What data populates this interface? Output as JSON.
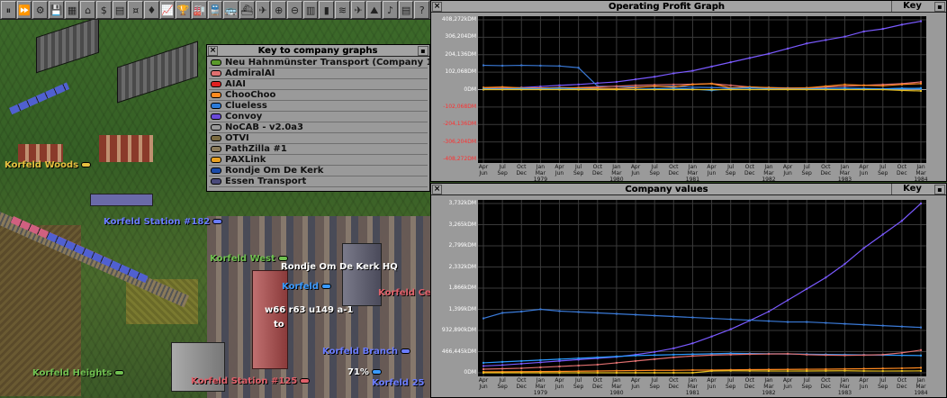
{
  "toolbar": {
    "buttons": [
      {
        "name": "pause-button",
        "glyph": "⏸"
      },
      {
        "name": "fast-forward-button",
        "glyph": "⏩"
      },
      {
        "name": "settings-button",
        "glyph": "⚙"
      },
      {
        "name": "save-button",
        "glyph": "💾"
      },
      {
        "name": "minimap-button",
        "glyph": "▦"
      },
      {
        "name": "towns-button",
        "glyph": "⌂"
      },
      {
        "name": "subsidies-button",
        "glyph": "$"
      },
      {
        "name": "stations-button",
        "glyph": "▤"
      },
      {
        "name": "finances-button",
        "glyph": "¤"
      },
      {
        "name": "company-button",
        "glyph": "♦"
      },
      {
        "name": "graphs-button",
        "glyph": "📈"
      },
      {
        "name": "league-button",
        "glyph": "🏆"
      },
      {
        "name": "industries-button",
        "glyph": "🏭"
      },
      {
        "name": "trains-button",
        "glyph": "🚆"
      },
      {
        "name": "road-vehicles-button",
        "glyph": "🚌"
      },
      {
        "name": "ships-button",
        "glyph": "⛴"
      },
      {
        "name": "aircraft-button",
        "glyph": "✈"
      },
      {
        "name": "zoom-in-button",
        "glyph": "⊕"
      },
      {
        "name": "zoom-out-button",
        "glyph": "⊖"
      },
      {
        "name": "build-rail-button",
        "glyph": "▥"
      },
      {
        "name": "build-road-button",
        "glyph": "▮"
      },
      {
        "name": "build-water-button",
        "glyph": "≋"
      },
      {
        "name": "build-air-button",
        "glyph": "✈"
      },
      {
        "name": "landscaping-button",
        "glyph": "⛰"
      },
      {
        "name": "sound-button",
        "glyph": "♪"
      },
      {
        "name": "news-button",
        "glyph": "▤"
      },
      {
        "name": "help-button",
        "glyph": "?"
      }
    ]
  },
  "map": {
    "labels": [
      {
        "text": "Korfeld Woods",
        "color": "#e8c040",
        "pill": "#e8c040"
      },
      {
        "text": "Korfeld Station #182",
        "color": "#5a6cff",
        "pill": "#6a7cff"
      },
      {
        "text": "Korfeld West",
        "color": "#70c050",
        "pill": "#70c050"
      },
      {
        "text": "Rondje Om De Kerk HQ",
        "color": "#ffffff",
        "pill": ""
      },
      {
        "text": "Korfeld",
        "color": "#3a9aff",
        "pill": "#3a9aff"
      },
      {
        "text": "Korfeld Cen",
        "color": "#e0606a",
        "pill": ""
      },
      {
        "text": "w66 r63 u149 a-1",
        "color": "#ffffff",
        "pill": ""
      },
      {
        "text": "to",
        "color": "#ffffff",
        "pill": ""
      },
      {
        "text": "Korfeld Branch",
        "color": "#5a6cff",
        "pill": "#6a7cff"
      },
      {
        "text": "71%",
        "color": "#ffffff",
        "pill": "#3a9aff"
      },
      {
        "text": "Korfeld Heights",
        "color": "#70c050",
        "pill": "#70c050"
      },
      {
        "text": "Korfeld Station #125",
        "color": "#e0606a",
        "pill": "#e0606a"
      },
      {
        "text": "Korfeld 25",
        "color": "#5a6cff",
        "pill": ""
      }
    ]
  },
  "key_window": {
    "title": "Key to company graphs",
    "companies": [
      {
        "name": "Neu Hahnmünster Transport (Company 1)",
        "color": "#5a9a2a"
      },
      {
        "name": "AdmiralAI",
        "color": "#e07070"
      },
      {
        "name": "AIAI",
        "color": "#e02020"
      },
      {
        "name": "ChooChoo",
        "color": "#ff8a20"
      },
      {
        "name": "Clueless",
        "color": "#2a7ad8"
      },
      {
        "name": "Convoy",
        "color": "#6a4ad8"
      },
      {
        "name": "NoCAB - v2.0a3",
        "color": "#9a9a9a"
      },
      {
        "name": "OTVI",
        "color": "#7a6a40"
      },
      {
        "name": "PathZilla #1",
        "color": "#8a7a5a"
      },
      {
        "name": "PAXLink",
        "color": "#e8a020"
      },
      {
        "name": "Rondje Om De Kerk",
        "color": "#1a4aa8"
      },
      {
        "name": "Essen Transport",
        "color": "#4a4a7a"
      }
    ]
  },
  "profit_graph": {
    "title": "Operating Profit Graph",
    "key_label": "Key"
  },
  "value_graph": {
    "title": "Company values",
    "key_label": "Key"
  },
  "chart_data": [
    {
      "type": "line",
      "title": "Operating Profit Graph",
      "ylim": [
        -408272,
        408272
      ],
      "ytick_labels": [
        "408,272kDM",
        "306,204DM",
        "204,136DM",
        "102,068DM",
        "0DM",
        "-102,068DM",
        "-204,136DM",
        "-306,204DM",
        "-408,272DM"
      ],
      "ytick_values": [
        408272,
        306204,
        204136,
        102068,
        0,
        -102068,
        -204136,
        -306204,
        -408272
      ],
      "x_top": [
        "Apr",
        "Jul",
        "Oct",
        "Jan",
        "Apr",
        "Jul",
        "Oct",
        "Jan",
        "Apr",
        "Jul",
        "Oct",
        "Jan",
        "Apr",
        "Jul",
        "Oct",
        "Jan",
        "Apr",
        "Jul",
        "Oct",
        "Jan",
        "Apr",
        "Jul",
        "Oct",
        "Jan"
      ],
      "x_bottom": [
        "Jun",
        "Sep",
        "Dec",
        "Mar",
        "Jun",
        "Sep",
        "Dec",
        "Mar",
        "Jun",
        "Sep",
        "Dec",
        "Mar",
        "Jun",
        "Sep",
        "Dec",
        "Mar",
        "Jun",
        "Sep",
        "Dec",
        "Mar",
        "Jun",
        "Sep",
        "Dec",
        "Mar"
      ],
      "x_year": [
        "",
        "",
        "",
        "1979",
        "",
        "",
        "",
        "1980",
        "",
        "",
        "",
        "1981",
        "",
        "",
        "",
        "1982",
        "",
        "",
        "",
        "1983",
        "",
        "",
        "",
        "1984"
      ],
      "series": [
        {
          "name": "Convoy",
          "color": "#7a5aff",
          "values": [
            5000,
            8000,
            12000,
            18000,
            25000,
            30000,
            38000,
            45000,
            60000,
            75000,
            95000,
            110000,
            135000,
            160000,
            185000,
            210000,
            240000,
            270000,
            290000,
            310000,
            340000,
            355000,
            380000,
            400000
          ]
        },
        {
          "name": "Rondje Om De Kerk",
          "color": "#3a7ad8",
          "values": [
            142000,
            140000,
            142000,
            140000,
            138000,
            128000,
            20000,
            18000,
            15000,
            18000,
            20000,
            14000,
            12000,
            10000,
            8000,
            12000,
            10000,
            8000,
            6000,
            9000,
            7000,
            5000,
            8000,
            6000
          ]
        },
        {
          "name": "AdmiralAI",
          "color": "#e07070",
          "values": [
            8000,
            6000,
            9000,
            10000,
            7000,
            12000,
            15000,
            20000,
            25000,
            28000,
            30000,
            32000,
            35000,
            25000,
            15000,
            10000,
            8000,
            10000,
            15000,
            20000,
            25000,
            30000,
            35000,
            45000
          ]
        },
        {
          "name": "ChooChoo",
          "color": "#ff8a20",
          "values": [
            12000,
            15000,
            10000,
            8000,
            12000,
            10000,
            8000,
            6000,
            12000,
            20000,
            15000,
            30000,
            35000,
            10000,
            15000,
            12000,
            8000,
            10000,
            20000,
            30000,
            25000,
            22000,
            30000,
            35000
          ]
        },
        {
          "name": "Clueless",
          "color": "#2a9aff",
          "values": [
            5000,
            4000,
            6000,
            5000,
            8000,
            4000,
            2000,
            0,
            3000,
            5000,
            8000,
            3000,
            -5000,
            6000,
            10000,
            5000,
            2000,
            4000,
            6000,
            8000,
            5000,
            4000,
            6000,
            8000
          ]
        },
        {
          "name": "PAXLink",
          "color": "#e8c020",
          "values": [
            0,
            0,
            0,
            0,
            0,
            0,
            0,
            0,
            0,
            0,
            0,
            0,
            0,
            0,
            0,
            0,
            0,
            0,
            0,
            0,
            0,
            0,
            -5000,
            -8000
          ]
        }
      ]
    },
    {
      "type": "line",
      "title": "Company values",
      "ylim": [
        0,
        3732000
      ],
      "ytick_labels": [
        "3,732kDM",
        "3,265kDM",
        "2,799kDM",
        "2,332kDM",
        "1,866kDM",
        "1,399kDM",
        "932,890kDM",
        "466,445kDM",
        "0DM"
      ],
      "ytick_values": [
        3732000,
        3265000,
        2799000,
        2332000,
        1866000,
        1399000,
        932890,
        466445,
        0
      ],
      "x_top": [
        "Apr",
        "Jul",
        "Oct",
        "Jan",
        "Apr",
        "Jul",
        "Oct",
        "Jan",
        "Apr",
        "Jul",
        "Oct",
        "Jan",
        "Apr",
        "Jul",
        "Oct",
        "Jan",
        "Apr",
        "Jul",
        "Oct",
        "Jan",
        "Apr",
        "Jul",
        "Oct",
        "Jan"
      ],
      "x_bottom": [
        "Jun",
        "Sep",
        "Dec",
        "Mar",
        "Jun",
        "Sep",
        "Dec",
        "Mar",
        "Jun",
        "Sep",
        "Dec",
        "Mar",
        "Jun",
        "Sep",
        "Dec",
        "Mar",
        "Jun",
        "Sep",
        "Dec",
        "Mar",
        "Jun",
        "Sep",
        "Dec",
        "Mar"
      ],
      "x_year": [
        "",
        "",
        "",
        "1979",
        "",
        "",
        "",
        "1980",
        "",
        "",
        "",
        "1981",
        "",
        "",
        "",
        "1982",
        "",
        "",
        "",
        "1983",
        "",
        "",
        "",
        "1984"
      ],
      "series": [
        {
          "name": "Convoy",
          "color": "#7a5aff",
          "values": [
            150000,
            170000,
            200000,
            230000,
            260000,
            290000,
            320000,
            350000,
            400000,
            460000,
            540000,
            650000,
            800000,
            960000,
            1150000,
            1350000,
            1600000,
            1850000,
            2100000,
            2400000,
            2750000,
            3050000,
            3350000,
            3732000
          ]
        },
        {
          "name": "Rondje Om De Kerk",
          "color": "#3a7ad8",
          "values": [
            1200000,
            1320000,
            1350000,
            1400000,
            1360000,
            1340000,
            1320000,
            1300000,
            1280000,
            1260000,
            1240000,
            1220000,
            1200000,
            1180000,
            1160000,
            1140000,
            1120000,
            1120000,
            1100000,
            1080000,
            1060000,
            1040000,
            1020000,
            1000000
          ]
        },
        {
          "name": "Clueless",
          "color": "#2a9aff",
          "values": [
            220000,
            240000,
            260000,
            280000,
            300000,
            320000,
            340000,
            360000,
            380000,
            390000,
            400000,
            410000,
            420000,
            430000,
            425000,
            420000,
            415000,
            410000,
            405000,
            400000,
            395000,
            390000,
            385000,
            380000
          ]
        },
        {
          "name": "AdmiralAI",
          "color": "#e07070",
          "values": [
            80000,
            90000,
            100000,
            120000,
            140000,
            160000,
            180000,
            220000,
            260000,
            300000,
            340000,
            370000,
            390000,
            400000,
            410000,
            415000,
            420000,
            400000,
            390000,
            385000,
            390000,
            400000,
            440000,
            500000
          ]
        },
        {
          "name": "ChooChoo",
          "color": "#ff8a20",
          "values": [
            20000,
            22000,
            25000,
            28000,
            30000,
            35000,
            40000,
            45000,
            50000,
            55000,
            55000,
            60000,
            60000,
            65000,
            70000,
            72000,
            75000,
            78000,
            80000,
            85000,
            90000,
            95000,
            100000,
            110000
          ]
        },
        {
          "name": "PAXLink",
          "color": "#e8c020",
          "values": [
            0,
            0,
            0,
            0,
            0,
            0,
            0,
            0,
            0,
            0,
            0,
            0,
            40000,
            45000,
            42000,
            40000,
            38000,
            40000,
            42000,
            45000,
            40000,
            38000,
            40000,
            42000
          ]
        }
      ]
    }
  ]
}
